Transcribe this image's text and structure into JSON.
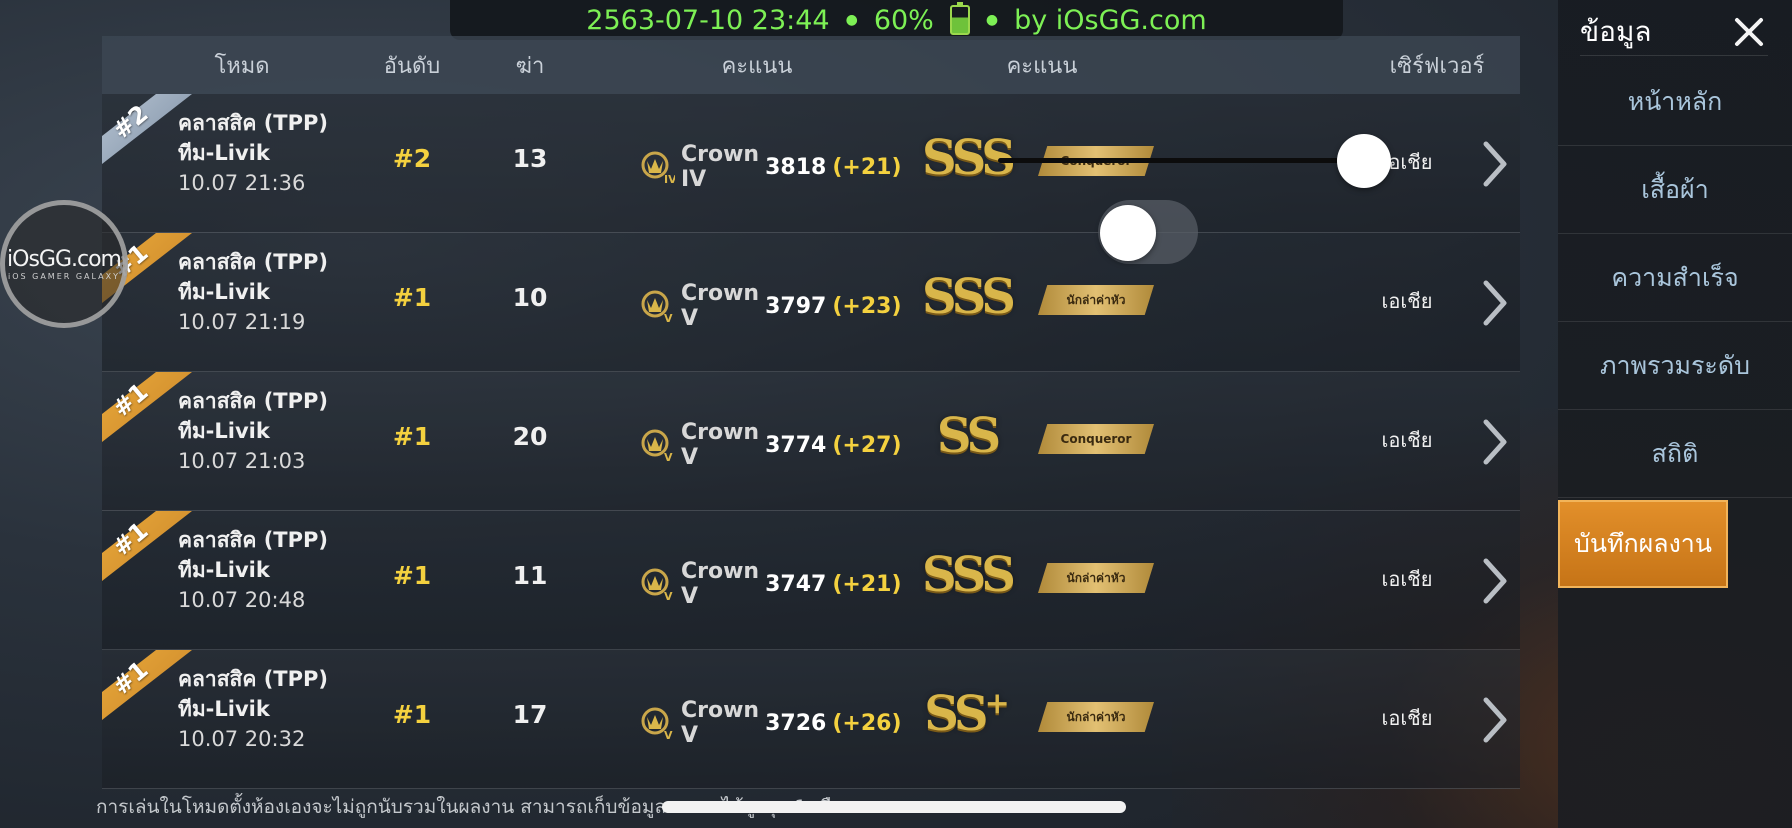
{
  "status": {
    "datetime": "2563-07-10 23:44",
    "battery": "60%",
    "by": "by iOsGG.com"
  },
  "table": {
    "headers": {
      "mode": "โหมด",
      "rank": "อันดับ",
      "kills": "ฆ่า",
      "score": "คะแนน",
      "score2": "คะแนน",
      "server": "เซิร์ฟเวอร์"
    },
    "rows": [
      {
        "ribbon": "#2",
        "ribbon_color": "silver",
        "mode": "คลาสสิค (TPP)",
        "map": "ทีม-Livik",
        "date": "10.07 21:36",
        "rank": "#2",
        "kills": "13",
        "tier": "Crown IV",
        "tier_badge": "IV",
        "points": "3818",
        "delta": "(+21)",
        "grade": "SSS",
        "grade_plus": "",
        "title": "Conqueror",
        "server": "เอเชีย"
      },
      {
        "ribbon": "#1",
        "ribbon_color": "gold",
        "mode": "คลาสสิค (TPP)",
        "map": "ทีม-Livik",
        "date": "10.07 21:19",
        "rank": "#1",
        "kills": "10",
        "tier": "Crown V",
        "tier_badge": "V",
        "points": "3797",
        "delta": "(+23)",
        "grade": "SSS",
        "grade_plus": "",
        "title": "นักล่าค่าหัว",
        "server": "เอเชีย"
      },
      {
        "ribbon": "#1",
        "ribbon_color": "gold",
        "mode": "คลาสสิค (TPP)",
        "map": "ทีม-Livik",
        "date": "10.07 21:03",
        "rank": "#1",
        "kills": "20",
        "tier": "Crown V",
        "tier_badge": "V",
        "points": "3774",
        "delta": "(+27)",
        "grade": "SS",
        "grade_plus": "",
        "title": "Conqueror",
        "server": "เอเชีย"
      },
      {
        "ribbon": "#1",
        "ribbon_color": "gold",
        "mode": "คลาสสิค (TPP)",
        "map": "ทีม-Livik",
        "date": "10.07 20:48",
        "rank": "#1",
        "kills": "11",
        "tier": "Crown V",
        "tier_badge": "V",
        "points": "3747",
        "delta": "(+21)",
        "grade": "SSS",
        "grade_plus": "",
        "title": "นักล่าค่าหัว",
        "server": "เอเชีย"
      },
      {
        "ribbon": "#1",
        "ribbon_color": "gold",
        "mode": "คลาสสิค (TPP)",
        "map": "ทีม-Livik",
        "date": "10.07 20:32",
        "rank": "#1",
        "kills": "17",
        "tier": "Crown V",
        "tier_badge": "V",
        "points": "3726",
        "delta": "(+26)",
        "grade": "SS",
        "grade_plus": "+",
        "title": "นักล่าค่าหัว",
        "server": "เอเชีย"
      }
    ]
  },
  "footer_note": "การเล่นในโหมดตั้งห้องเองจะไม่ถูกนับรวมในผลงาน สามารถเก็บข้อมูลผลงานได้สูงสุด 1 เดือน",
  "watermark": {
    "main": "iOsGG.com",
    "sub": "iOS GAMER GALAXY"
  },
  "side_panel": {
    "title": "ข้อมูล",
    "items": [
      "หน้าหลัก",
      "เสื้อผ้า",
      "ความสำเร็จ",
      "ภาพรวมระดับ",
      "สถิติ",
      "บันทึกผลงาน"
    ],
    "active_index": 5
  },
  "colors": {
    "accent": "#f4d13f",
    "active_tab": "#d9821f",
    "status_text": "#7df055"
  }
}
